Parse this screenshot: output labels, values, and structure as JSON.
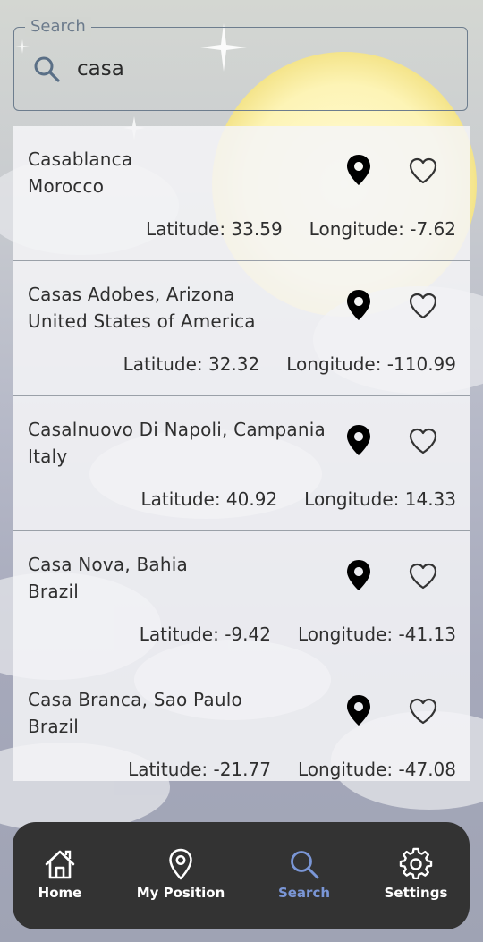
{
  "search": {
    "legend": "Search",
    "query": "casa"
  },
  "results": [
    {
      "name": "Casablanca",
      "country": "Morocco",
      "latitude": "Latitude: 33.59",
      "longitude": "Longitude: -7.62"
    },
    {
      "name": "Casas Adobes, Arizona",
      "country": "United States of America",
      "latitude": "Latitude: 32.32",
      "longitude": "Longitude: -110.99"
    },
    {
      "name": "Casalnuovo Di Napoli, Campania",
      "country": "Italy",
      "latitude": "Latitude: 40.92",
      "longitude": "Longitude: 14.33"
    },
    {
      "name": "Casa Nova, Bahia",
      "country": "Brazil",
      "latitude": "Latitude: -9.42",
      "longitude": "Longitude: -41.13"
    },
    {
      "name": "Casa Branca, Sao Paulo",
      "country": "Brazil",
      "latitude": "Latitude: -21.77",
      "longitude": "Longitude: -47.08"
    }
  ],
  "nav": {
    "items": [
      {
        "label": "Home",
        "icon": "home-icon",
        "active": false
      },
      {
        "label": "My Position",
        "icon": "location-pin-icon",
        "active": false
      },
      {
        "label": "Search",
        "icon": "search-icon",
        "active": true
      },
      {
        "label": "Settings",
        "icon": "gear-icon",
        "active": false
      }
    ]
  },
  "colors": {
    "accent": "#7a96d6",
    "nav_background": "#333333",
    "field_border": "#6d7d8e"
  }
}
